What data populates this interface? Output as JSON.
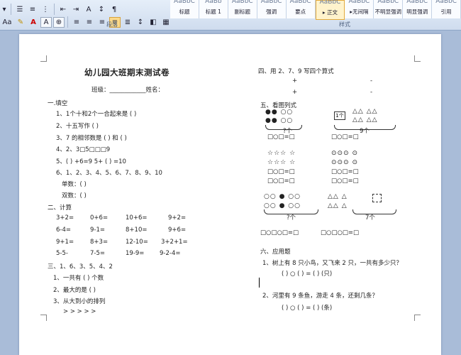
{
  "ribbon": {
    "font_size_label": "Aa",
    "paragraph_group": "段落",
    "styles_group": "样式",
    "styles": [
      {
        "label": "标题",
        "selected": false
      },
      {
        "label": "标题 1",
        "selected": false
      },
      {
        "label": "副标题",
        "selected": false
      },
      {
        "label": "强调",
        "selected": false
      },
      {
        "label": "要点",
        "selected": false
      },
      {
        "label": "正文",
        "selected": true
      },
      {
        "label": "无间隔",
        "selected": false
      },
      {
        "label": "不明显强调",
        "selected": false
      },
      {
        "label": "明显强调",
        "selected": false
      },
      {
        "label": "引用",
        "selected": false
      }
    ]
  },
  "doc": {
    "title": "幼儿园大班期末测试卷",
    "class_line": "班级：____________姓名：",
    "s1": "一.填空",
    "q1": "1、1个十和2个一合起来是 (        )",
    "q2": "2、十五写作 (          )",
    "q3": "3、7 的相邻数是   (        ) 和 (        )",
    "q4": "4、2、3□5□□□9",
    "q5": "5、(      ) +6=9          5+ (      ) =10",
    "q6": "6、1、2、3、4、5、6、7、8、9、10",
    "q6a": "单数：(                                        )",
    "q6b": "双数：(                                        )",
    "s2": "二、计算",
    "calc": [
      [
        "3+2=",
        "0+6=",
        "10+6=",
        "9+2="
      ],
      [
        "6-4=",
        "9-1=",
        "8+10=",
        "9+6="
      ],
      [
        "9+1=",
        "8+3=",
        "12-10=",
        "3+2+1="
      ],
      [
        "5-5-",
        "7-5=",
        "19-9=",
        "9-2-4="
      ]
    ],
    "s3": "三、1、6、3、5、4、2",
    "s3a": "1、一共有 (    ) 个数",
    "s3b": "2、最大的是 (      )",
    "s3c": "3、从大到小的排列",
    "s3d": ">          >          >          >          >",
    "s4": "四、用 2、7、9 写四个算式",
    "plus": "+",
    "minus": "-",
    "s5": "五、看图列式",
    "d1a": "●●   ○○",
    "d1b": "●●   ○○",
    "d1c": "?个",
    "d2box": "1个",
    "d2a": "△△ △△",
    "d2b": "9个",
    "eq1": "□○□=□",
    "d3a": "☆☆☆   ☆",
    "d3b": "☆☆☆   ☆",
    "d4a": "⊙⊙⊙   ⊙",
    "d4b": "⊙⊙⊙   ⊙",
    "eq2": "□○□=□",
    "d5": "○○   ●   ○○",
    "d5b": "○○   ●   ○○",
    "d5c": "?个",
    "d6a": "△△   △",
    "d6b": "△△   △",
    "d6c": "7个",
    "eq3": "□○□○□=□",
    "s6": "六、应用题",
    "a1": "1、树上有 8 只小鸟，又飞来 2 只，一共有多少只？",
    "a1f": "(      ) ○ (      ) = (      ) (只)",
    "a2": "2、河里有 9 条鱼，游走 4 条，还剩几条？",
    "a2f": "(      ) ○ (      ) = (      ) (条)"
  }
}
